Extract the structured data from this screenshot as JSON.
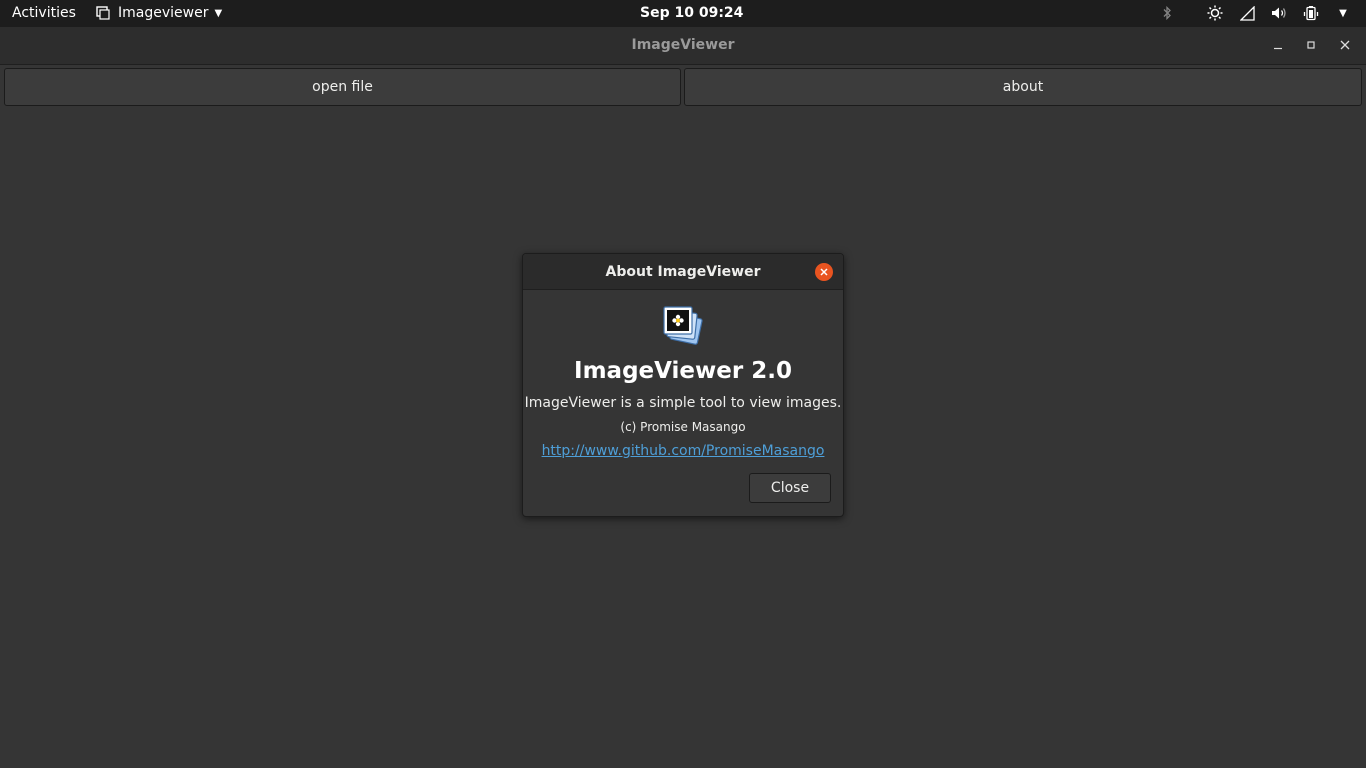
{
  "topbar": {
    "activities_label": "Activities",
    "app_menu_label": "Imageviewer",
    "clock": "Sep 10  09:24",
    "tray_icons": [
      "bluetooth-icon",
      "brightness-icon",
      "network-icon",
      "volume-icon",
      "battery-icon",
      "system-menu-caret-icon"
    ]
  },
  "window": {
    "title": "ImageViewer"
  },
  "toolbar": {
    "open_file_label": "open file",
    "about_label": "about"
  },
  "about_dialog": {
    "title": "About ImageViewer",
    "program_name": "ImageViewer 2.0",
    "comments": "ImageViewer is a simple tool to view images.",
    "copyright": "(c) Promise Masango",
    "website": "http://www.github.com/PromiseMasango",
    "close_label": "Close",
    "accent_color": "#e95420",
    "link_color": "#4e9fd8"
  }
}
